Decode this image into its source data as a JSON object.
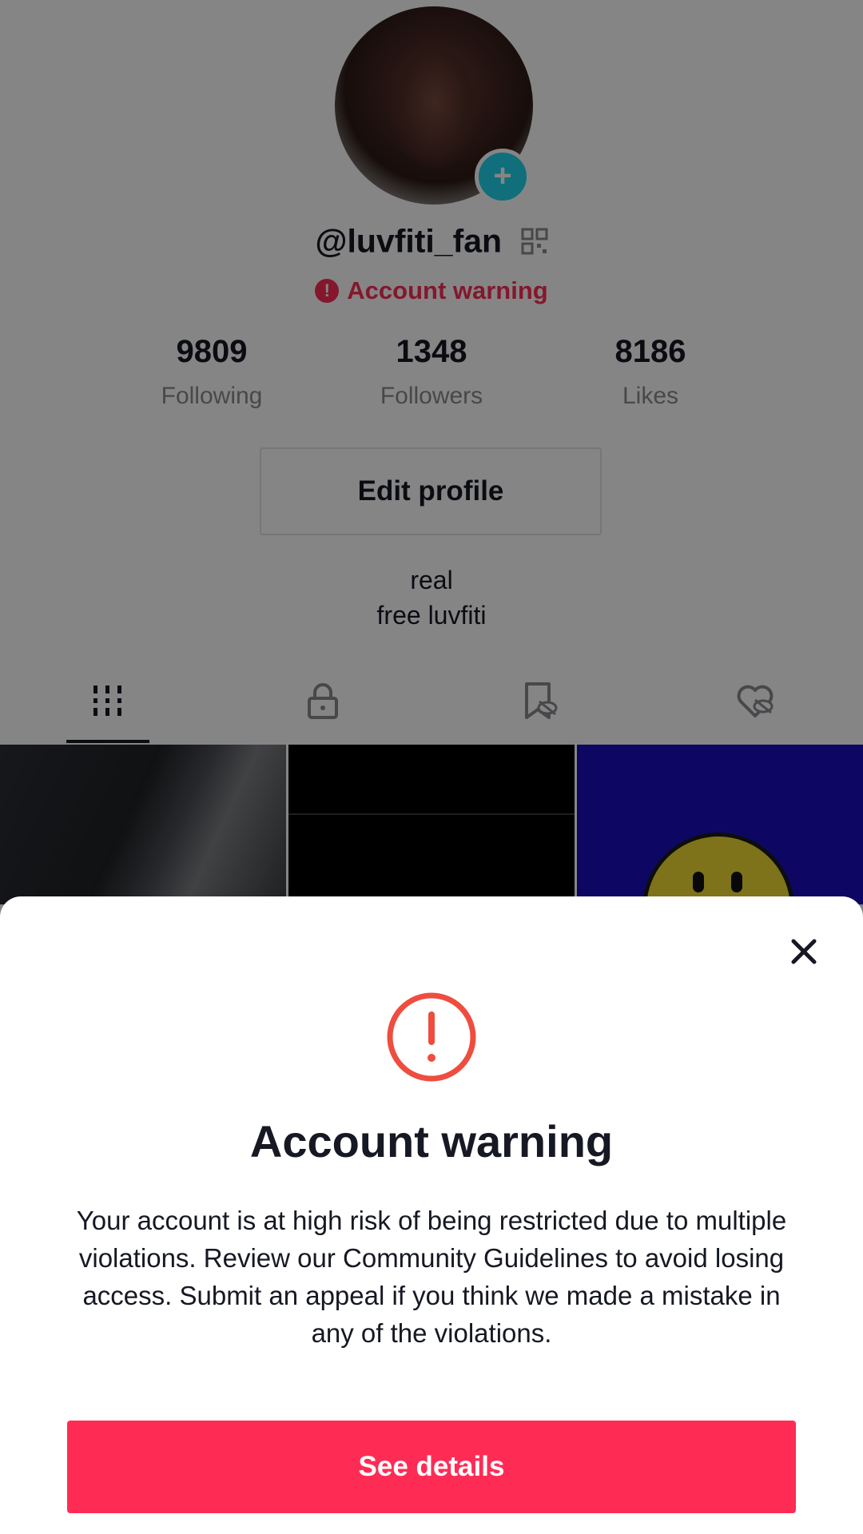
{
  "profile": {
    "username": "@luvfiti_fan",
    "warning_label": "Account warning",
    "stats": [
      {
        "value": "9809",
        "label": "Following"
      },
      {
        "value": "1348",
        "label": "Followers"
      },
      {
        "value": "8186",
        "label": "Likes"
      }
    ],
    "edit_profile_label": "Edit profile",
    "bio_lines": [
      "real",
      "free luvfiti"
    ]
  },
  "tabs": [
    {
      "icon": "grid-icon",
      "active": true
    },
    {
      "icon": "lock-icon",
      "active": false
    },
    {
      "icon": "bookmark-hidden-icon",
      "active": false
    },
    {
      "icon": "liked-hidden-icon",
      "active": false
    }
  ],
  "sheet": {
    "title": "Account warning",
    "body": "Your account is at high risk of being restricted due to multiple violations. Review our Community Guidelines to avoid losing access. Submit an appeal if you think we made a mistake in any of the violations.",
    "cta_label": "See details"
  },
  "colors": {
    "accent": "#fe2c55",
    "warning_icon": "#ee4d3f",
    "avatar_badge": "#20d5ec"
  }
}
